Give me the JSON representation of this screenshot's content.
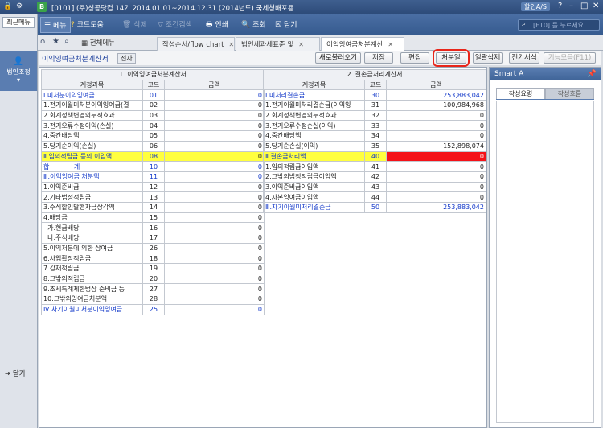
{
  "titlebar": {
    "text": "[0101] (주)성공닷컴    14기  2014.01.01~2014.12.31  (2014년도)    국세청배포용",
    "right": "할인A/S"
  },
  "toolbar": {
    "menu": "메뉴",
    "code_help": "코드도움",
    "delete": "삭제",
    "cond_search": "조건검색",
    "print": "인쇄",
    "lookup": "조회",
    "close": "닫기",
    "search_placeholder": "[F10] 를 누르세요"
  },
  "leftnav": {
    "recent": "최근메뉴",
    "section": "법인조정",
    "close": "닫기"
  },
  "tabs": [
    "전체메뉴",
    "작성순서/flow chart",
    "법인세과세표준 및",
    "이익잉여금처분계산"
  ],
  "subbar": {
    "title": "이익잉여금처분계산서",
    "badge": "전자"
  },
  "actions": [
    "새로불러오기",
    "저장",
    "편집",
    "처분일",
    "일괄삭제",
    "전기서식",
    "기능모음(F11)"
  ],
  "left_table": {
    "title": "1. 이익잉여금처분계산서",
    "headers": [
      "계정과목",
      "코드",
      "금액"
    ],
    "rows": [
      {
        "name": "Ⅰ.미처분이익잉여금",
        "code": "01",
        "amount": "0",
        "style": "blue"
      },
      {
        "name": "1.전기이월미처분이익잉여금(결",
        "code": "02",
        "amount": "0",
        "style": ""
      },
      {
        "name": "2.회계정책변경의누적효과",
        "code": "03",
        "amount": "0",
        "style": ""
      },
      {
        "name": "3.전기오류수정이익(손실)",
        "code": "04",
        "amount": "0",
        "style": ""
      },
      {
        "name": "4.중간배당액",
        "code": "05",
        "amount": "0",
        "style": ""
      },
      {
        "name": "5.당기순이익(손실)",
        "code": "06",
        "amount": "0",
        "style": ""
      },
      {
        "name": "Ⅱ.임의적립금 등의 이입액",
        "code": "08",
        "amount": "0",
        "style": "yellow"
      },
      {
        "name": "합            계",
        "code": "10",
        "amount": "0",
        "style": "blue"
      },
      {
        "name": "Ⅲ.이익잉여금 처분액",
        "code": "11",
        "amount": "0",
        "style": "blue"
      },
      {
        "name": "1.이익준비금",
        "code": "12",
        "amount": "0",
        "style": ""
      },
      {
        "name": "2.기타법정적립금",
        "code": "13",
        "amount": "0",
        "style": ""
      },
      {
        "name": "3.주식할인발행차금상각액",
        "code": "14",
        "amount": "0",
        "style": ""
      },
      {
        "name": "4.배당금",
        "code": "15",
        "amount": "0",
        "style": ""
      },
      {
        "name": "  가.현금배당",
        "code": "16",
        "amount": "0",
        "style": ""
      },
      {
        "name": "  나.주식배당",
        "code": "17",
        "amount": "0",
        "style": ""
      },
      {
        "name": "5.이익처분에 의한 상여금",
        "code": "26",
        "amount": "0",
        "style": ""
      },
      {
        "name": "6.사업확장적립금",
        "code": "18",
        "amount": "0",
        "style": ""
      },
      {
        "name": "7.감채적립금",
        "code": "19",
        "amount": "0",
        "style": ""
      },
      {
        "name": "8.그밖의적립금",
        "code": "20",
        "amount": "0",
        "style": ""
      },
      {
        "name": "9.조세특례제한법상 준비금 등",
        "code": "27",
        "amount": "0",
        "style": ""
      },
      {
        "name": "10.그밖의잉여금처분액",
        "code": "28",
        "amount": "0",
        "style": ""
      },
      {
        "name": "Ⅳ.차기이월미처분이익잉여금",
        "code": "25",
        "amount": "0",
        "style": "blue"
      }
    ]
  },
  "right_table": {
    "title": "2. 결손금처리계산서",
    "headers": [
      "계정과목",
      "코드",
      "금액"
    ],
    "rows": [
      {
        "name": "Ⅰ.미처리결손금",
        "code": "30",
        "amount": "253,883,042",
        "style": "blue"
      },
      {
        "name": "1.전기이월미처리결손금(이익잉",
        "code": "31",
        "amount": "100,984,968",
        "style": ""
      },
      {
        "name": "2.회계정책변경의누적효과",
        "code": "32",
        "amount": "0",
        "style": ""
      },
      {
        "name": "3.전기오류수정손실(이익)",
        "code": "33",
        "amount": "0",
        "style": ""
      },
      {
        "name": "4.중간배당액",
        "code": "34",
        "amount": "0",
        "style": ""
      },
      {
        "name": "5.당기순손실(이익)",
        "code": "35",
        "amount": "152,898,074",
        "style": ""
      },
      {
        "name": "Ⅱ.결손금처리액",
        "code": "40",
        "amount": "0",
        "style": "yellow"
      },
      {
        "name": "1.임의적립금이입액",
        "code": "41",
        "amount": "0",
        "style": ""
      },
      {
        "name": "2.그밖의법정적립금이입액",
        "code": "42",
        "amount": "0",
        "style": ""
      },
      {
        "name": "3.이익준비금이입액",
        "code": "43",
        "amount": "0",
        "style": ""
      },
      {
        "name": "4.자본잉여금이입액",
        "code": "44",
        "amount": "0",
        "style": ""
      },
      {
        "name": "Ⅲ.차기이월미처리결손금",
        "code": "50",
        "amount": "253,883,042",
        "style": "blue"
      }
    ]
  },
  "smart": {
    "title": "Smart A",
    "tabs": [
      "작성요령",
      "작성흐름"
    ]
  }
}
